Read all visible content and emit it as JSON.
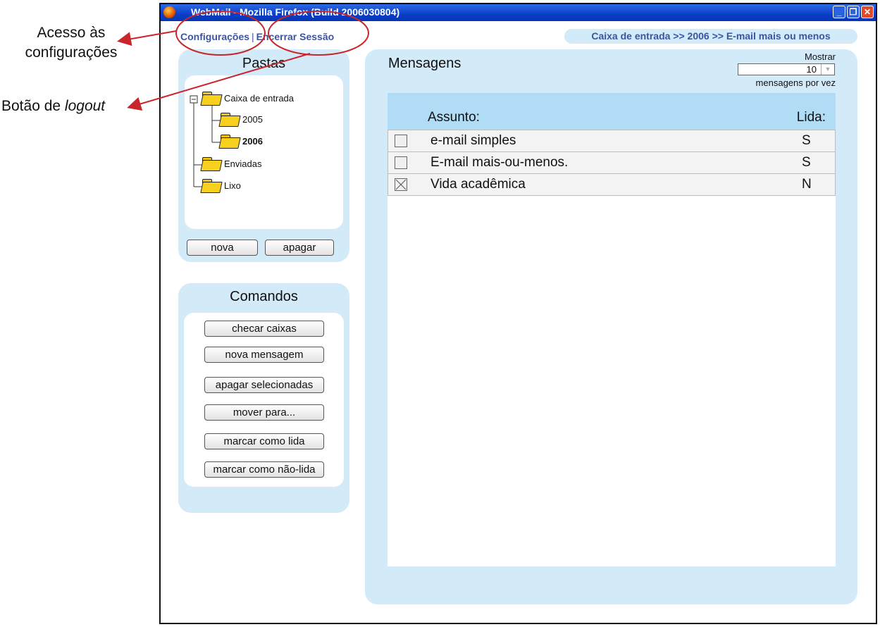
{
  "annotations": {
    "settings_access_line1": "Acesso às",
    "settings_access_line2": "configurações",
    "logout_prefix": "Botão de",
    "logout_word": "logout"
  },
  "window": {
    "title": "WebMail - Mozilla Firefox (Build 2006030804)"
  },
  "top_links": {
    "settings": "Configurações",
    "separator": "|",
    "logout": "Encerrar Sessão"
  },
  "breadcrumb": "Caixa de entrada >> 2006 >> E-mail mais ou menos",
  "folders_panel": {
    "title": "Pastas",
    "tree": [
      {
        "label": "Caixa de entrada",
        "expanded": true
      },
      {
        "label": "2005"
      },
      {
        "label": "2006",
        "selected": true
      },
      {
        "label": "Enviadas"
      },
      {
        "label": "Lixo"
      }
    ],
    "new_button": "nova",
    "delete_button": "apagar"
  },
  "commands_panel": {
    "title": "Comandos",
    "buttons": [
      "checar caixas",
      "nova mensagem",
      "apagar selecionadas",
      "mover para...",
      "marcar como lida",
      "marcar como não-lida"
    ]
  },
  "messages_panel": {
    "title": "Mensagens",
    "show_label": "Mostrar",
    "per_page": "10",
    "per_page_suffix": "mensagens por vez",
    "columns": {
      "subject": "Assunto:",
      "read": "Lida:"
    },
    "rows": [
      {
        "subject": "e-mail simples",
        "read": "S",
        "checked": false
      },
      {
        "subject": "E-mail mais-ou-menos.",
        "read": "S",
        "checked": false
      },
      {
        "subject": "Vida acadêmica",
        "read": "N",
        "checked": true
      }
    ]
  },
  "colors": {
    "panel_bg": "#d3eaf8",
    "header_bg": "#b0dcf6",
    "link": "#3c54a0",
    "annotation_red": "#c8262b",
    "titlebar": "#0a3ec7"
  },
  "icons": [
    "firefox-icon",
    "minimize-icon",
    "restore-icon",
    "close-icon",
    "folder-icon",
    "tree-collapse-icon",
    "dropdown-arrow-icon",
    "checkbox-icon"
  ]
}
